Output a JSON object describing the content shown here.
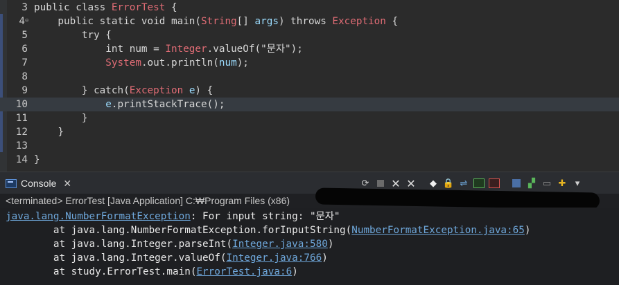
{
  "editor": {
    "lines": [
      {
        "num": "3",
        "tokens": [
          {
            "t": "public class ",
            "c": "plain"
          },
          {
            "t": "ErrorTest",
            "c": "cls"
          },
          {
            "t": " {",
            "c": "plain"
          }
        ]
      },
      {
        "num": "4",
        "fold": true,
        "tokens": [
          {
            "t": "    public static void main(",
            "c": "plain"
          },
          {
            "t": "String",
            "c": "cls"
          },
          {
            "t": "[] ",
            "c": "plain"
          },
          {
            "t": "args",
            "c": "var"
          },
          {
            "t": ") throws ",
            "c": "plain"
          },
          {
            "t": "Exception",
            "c": "cls"
          },
          {
            "t": " {",
            "c": "plain"
          }
        ]
      },
      {
        "num": "5",
        "tokens": [
          {
            "t": "        try {",
            "c": "plain"
          }
        ]
      },
      {
        "num": "6",
        "tokens": [
          {
            "t": "            int num = ",
            "c": "plain"
          },
          {
            "t": "Integer",
            "c": "cls"
          },
          {
            "t": ".valueOf(\"문자\");",
            "c": "plain"
          }
        ]
      },
      {
        "num": "7",
        "tokens": [
          {
            "t": "            ",
            "c": "plain"
          },
          {
            "t": "System",
            "c": "cls"
          },
          {
            "t": ".out.println(",
            "c": "plain"
          },
          {
            "t": "num",
            "c": "var"
          },
          {
            "t": ");",
            "c": "plain"
          }
        ]
      },
      {
        "num": "8",
        "tokens": []
      },
      {
        "num": "9",
        "tokens": [
          {
            "t": "        } catch(",
            "c": "plain"
          },
          {
            "t": "Exception",
            "c": "cls"
          },
          {
            "t": " ",
            "c": "plain"
          },
          {
            "t": "e",
            "c": "var"
          },
          {
            "t": ") {",
            "c": "plain"
          }
        ]
      },
      {
        "num": "10",
        "current": true,
        "tokens": [
          {
            "t": "            ",
            "c": "plain"
          },
          {
            "t": "e",
            "c": "var"
          },
          {
            "t": ".printStackTrace();",
            "c": "plain"
          }
        ]
      },
      {
        "num": "11",
        "tokens": [
          {
            "t": "        }",
            "c": "plain"
          }
        ]
      },
      {
        "num": "12",
        "tokens": [
          {
            "t": "    }",
            "c": "plain"
          }
        ]
      },
      {
        "num": "13",
        "tokens": []
      },
      {
        "num": "14",
        "tokens": [
          {
            "t": "}",
            "c": "plain"
          }
        ]
      }
    ]
  },
  "console_view": {
    "tab_label": "Console",
    "close_glyph": "✕",
    "status_text": "<terminated> ErrorTest [Java Application] C:₩Program Files (x86)",
    "toolbar_icons": [
      "refresh-icon",
      "stop-icon",
      "remove-launch-icon",
      "remove-all-icon",
      "clear-console-icon",
      "scroll-lock-icon",
      "word-wrap-icon",
      "show-stdout-icon",
      "show-stderr-icon",
      "pin-console-icon",
      "open-console-icon",
      "display-console-icon",
      "new-console-icon",
      "view-menu-icon"
    ]
  },
  "console_output": {
    "lines": [
      {
        "segments": [
          {
            "t": "java.lang.NumberFormatException",
            "link": true
          },
          {
            "t": ": For input string: \"문자\"",
            "link": false
          }
        ]
      },
      {
        "segments": [
          {
            "t": "\tat java.lang.NumberFormatException.forInputString(",
            "link": false
          },
          {
            "t": "NumberFormatException.java:65",
            "link": true
          },
          {
            "t": ")",
            "link": false
          }
        ]
      },
      {
        "segments": [
          {
            "t": "\tat java.lang.Integer.parseInt(",
            "link": false
          },
          {
            "t": "Integer.java:580",
            "link": true
          },
          {
            "t": ")",
            "link": false
          }
        ]
      },
      {
        "segments": [
          {
            "t": "\tat java.lang.Integer.valueOf(",
            "link": false
          },
          {
            "t": "Integer.java:766",
            "link": true
          },
          {
            "t": ")",
            "link": false
          }
        ]
      },
      {
        "segments": [
          {
            "t": "\tat study.ErrorTest.main(",
            "link": false
          },
          {
            "t": "ErrorTest.java:6",
            "link": true
          },
          {
            "t": ")",
            "link": false
          }
        ]
      }
    ]
  }
}
